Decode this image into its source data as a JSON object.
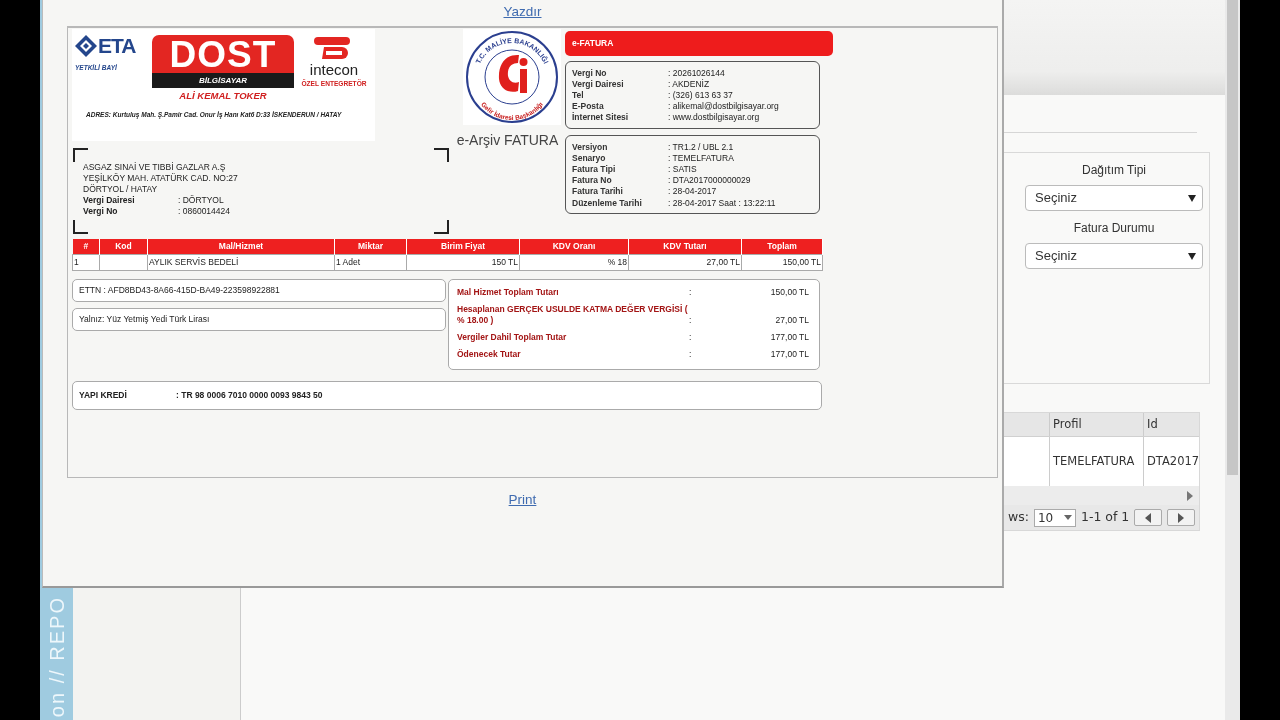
{
  "modal": {
    "print_top": "Yazdır",
    "print_bottom": "Print"
  },
  "invoice": {
    "seller_logo": {
      "brand_left": "ETA",
      "brand_left_sub": "YETKİLİ BAYİ",
      "brand_main": "DOST",
      "brand_main_sub": "BİLGİSAYAR",
      "owner": "ALİ KEMAL TOKER",
      "brand_right": "intecon",
      "brand_right_sub": "ÖZEL ENTEGRETÖR",
      "address_label": "ADRES:",
      "address": "Kurtuluş Mah. Ş.Pamir Cad. Onur İş Hanı Kat6 D:33 İSKENDERUN / HATAY"
    },
    "seal": {
      "top": "T.C. MALİYE BAKANLIĞI",
      "bottom": "Gelir İdaresi Başkanlığı"
    },
    "doc_type": "e-Arşiv FATURA",
    "badge": "e-FATURA",
    "seller_info": [
      {
        "label": "Vergi No",
        "value": ": 20261026144"
      },
      {
        "label": "Vergi Dairesi",
        "value": ": AKDENİZ"
      },
      {
        "label": "Tel",
        "value": ": (326) 613 63 37"
      },
      {
        "label": "E-Posta",
        "value": ": alikemal@dostbilgisayar.org"
      },
      {
        "label": "İnternet Sitesi",
        "value": ": www.dostbilgisayar.org"
      }
    ],
    "invoice_info": [
      {
        "label": "Versiyon",
        "value": ": TR1.2 / UBL 2.1"
      },
      {
        "label": "Senaryo",
        "value": ": TEMELFATURA"
      },
      {
        "label": "Fatura Tipi",
        "value": ": SATIS"
      },
      {
        "label": "Fatura No",
        "value": ": DTA2017000000029"
      },
      {
        "label": "Fatura Tarihi",
        "value": ": 28-04-2017"
      },
      {
        "label": "Düzenleme Tarihi",
        "value": ": 28-04-2017 Saat : 13:22:11"
      }
    ],
    "buyer": {
      "lines": [
        "ASGAZ SINAİ VE TIBBİ GAZLAR A.Ş",
        "YEŞİLKÖY MAH. ATATÜRK CAD. NO:27",
        "DÖRTYOL / HATAY"
      ],
      "fields": [
        {
          "label": "Vergi Dairesi",
          "value": ": DÖRTYOL"
        },
        {
          "label": "Vergi No",
          "value": ": 0860014424"
        }
      ]
    },
    "table": {
      "columns": [
        "#",
        "Kod",
        "Mal/Hizmet",
        "Miktar",
        "Birim Fiyat",
        "KDV Oranı",
        "KDV Tutarı",
        "Toplam"
      ],
      "rows": [
        [
          "1",
          null,
          "AYLIK SERVİS BEDELİ",
          "1 Adet",
          "150 TL",
          "% 18",
          "27,00 TL",
          "150,00 TL"
        ]
      ]
    },
    "ettn": "ETTN : AFD8BD43-8A66-415D-BA49-223598922881",
    "amount_in_words": "Yalnız: Yüz Yetmiş Yedi Türk Lirası",
    "totals": [
      {
        "label": "Mal Hizmet Toplam Tutarı",
        "sep": ":",
        "value": "150,00 TL"
      },
      {
        "label": "Hesaplanan GERÇEK USULDE KATMA DEĞER VERGİSİ ( % 18.00 )",
        "sep": ":",
        "value": "27,00 TL"
      },
      {
        "label": "Vergiler Dahil Toplam Tutar",
        "sep": ":",
        "value": "177,00 TL"
      },
      {
        "label": "Ödenecek Tutar",
        "sep": ":",
        "value": "177,00  TL"
      }
    ],
    "bank": {
      "name": "YAPI KREDİ",
      "iban": ": TR 98 0006 7010 0000 0093 9843 50"
    }
  },
  "background": {
    "side_text": "on // REPO",
    "filters": [
      {
        "label": "Dağıtım Tipi",
        "value": "Seçiniz"
      },
      {
        "label": "Fatura Durumu",
        "value": "Seçiniz"
      }
    ],
    "grid": {
      "columns": [
        "Profil",
        "Id"
      ],
      "rows": [
        [
          "TEMELFATURA",
          "DTA2017"
        ]
      ]
    },
    "pager": {
      "rows_label": "ws:",
      "page_size": "10",
      "range": "1-1 of 1"
    }
  }
}
